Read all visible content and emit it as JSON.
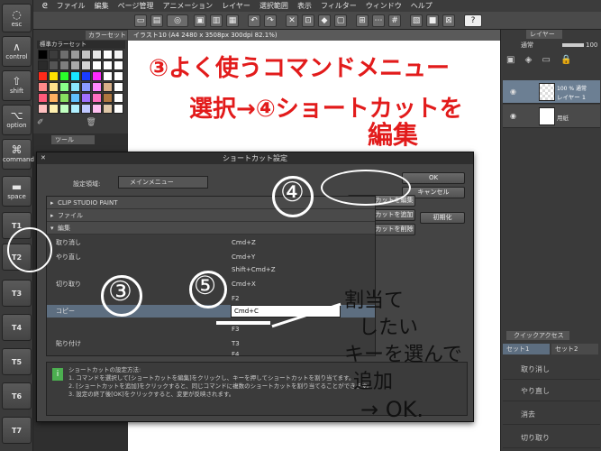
{
  "left_bar": {
    "buttons": [
      {
        "label": "esc",
        "icon": "ghost-icon"
      },
      {
        "label": "control",
        "icon": "caret-icon"
      },
      {
        "label": "shift",
        "icon": "shift-arrow-icon"
      },
      {
        "label": "option",
        "icon": "option-icon"
      },
      {
        "label": "command",
        "icon": "command-icon"
      },
      {
        "label": "space",
        "icon": "bar-icon"
      },
      {
        "label": "T1"
      },
      {
        "label": "T2"
      },
      {
        "label": "T3"
      },
      {
        "label": "T4"
      },
      {
        "label": "T5"
      },
      {
        "label": "T6"
      },
      {
        "label": "T7"
      }
    ]
  },
  "menu": {
    "items": [
      "ファイル",
      "編集",
      "ページ管理",
      "アニメーション",
      "レイヤー",
      "選択範囲",
      "表示",
      "フィルター",
      "ウィンドウ",
      "ヘルプ"
    ]
  },
  "color_panel": {
    "tab": "カラーセット",
    "set_name": "標準カラーセット",
    "colors": [
      "#000000",
      "#3c3c3c",
      "#6e6e6e",
      "#9a9a9a",
      "#c4c4c4",
      "#e6e6e6",
      "#ffffff",
      "#f4f4f4",
      "#2a2a2a",
      "#555555",
      "#7f7f7f",
      "#aaaaaa",
      "#d4d4d4",
      "#ffffff",
      "#ffffff",
      "#ffffff",
      "#ff2a1a",
      "#ffe000",
      "#2aff2a",
      "#18e6ff",
      "#1a3cff",
      "#ff2aff",
      "#ffffff",
      "#ffffff",
      "#ff8a8a",
      "#ffe08a",
      "#8aff8a",
      "#8ae6ff",
      "#8a9aff",
      "#ff8aff",
      "#d8b088",
      "#ffffff",
      "#ff5a7a",
      "#ffb060",
      "#88e060",
      "#60c0ff",
      "#a070ff",
      "#ff70c0",
      "#b07840",
      "#ffffff",
      "#ffc0c0",
      "#fff0b0",
      "#c0ffc0",
      "#b0f0ff",
      "#c0c8ff",
      "#ffc0f0",
      "#e0c8a8",
      "#ffffff"
    ],
    "sub_tab": "ツール"
  },
  "doc_tab": "イラスト10 (A4 2480 x 3508px 300dpi 82.1%)",
  "layer_panel": {
    "tab": "レイヤー",
    "blend_mode": "通常",
    "opacity_value": "100",
    "layers": [
      {
        "name": "100 % 通常",
        "sub": "レイヤー 1"
      },
      {
        "name": "用紙",
        "sub": ""
      }
    ],
    "qa_tab": "クイックアクセス",
    "qa_sets": [
      "セット1",
      "セット2"
    ],
    "qa_items": [
      "取り消し",
      "やり直し",
      "消去",
      "切り取り"
    ]
  },
  "dialog": {
    "title": "ショートカット設定",
    "setting_area_label": "設定領域:",
    "setting_area_value": "メインメニュー",
    "ok": "OK",
    "cancel": "キャンセル",
    "edit_shortcut": "ショートカットを編集",
    "add_shortcut": "ショートカットを追加",
    "delete_shortcut": "ショートカットを削除",
    "init": "初期化",
    "groups": [
      "CLIP STUDIO PAINT",
      "ファイル",
      "編集"
    ],
    "rows": [
      {
        "cmd": "取り消し",
        "key": "Cmd+Z"
      },
      {
        "cmd": "やり直し",
        "key": "Cmd+Y"
      },
      {
        "cmd": "",
        "key": "Shift+Cmd+Z"
      },
      {
        "cmd": "切り取り",
        "key": "Cmd+X"
      },
      {
        "cmd": "",
        "key": "F2"
      },
      {
        "cmd": "コピー",
        "key": "Cmd+C"
      },
      {
        "cmd": "",
        "key": "F3"
      },
      {
        "cmd": "貼り付け",
        "key": "T3"
      },
      {
        "cmd": "",
        "key": "F4"
      }
    ],
    "help_title": "ショートカットの設定方法:",
    "help_lines": [
      "1. コマンドを選択して[ショートカットを編集]をクリックし、キーを押してショートカットを割り当てます。",
      "2. [ショートカットを追加]をクリックすると、同じコマンドに複数のショートカットを割り当てることができます。",
      "3. 設定の終了後[OK]をクリックすると、変更が反映されます。"
    ]
  },
  "annotations": {
    "line1": "③よく使うコマンドメニュー",
    "line2": "選択→④ショートカットを",
    "line3": "編集",
    "num4": "④",
    "num3": "③",
    "num5": "⑤",
    "note1": "割当て",
    "note2": "したい",
    "note3": "キーを選んで",
    "note4": "追加",
    "note5": "→ OK."
  }
}
